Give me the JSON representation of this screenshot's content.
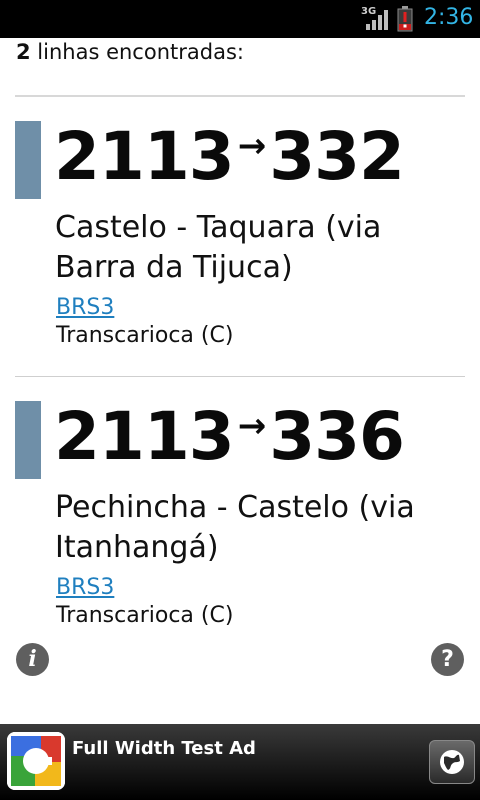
{
  "status_bar": {
    "network": "3G",
    "time": "2:36"
  },
  "results": {
    "count": "2",
    "count_label": " linhas encontradas:"
  },
  "lines": [
    {
      "from": "2113",
      "arrow": "→",
      "to": "332",
      "name": "Castelo - Taquara (via Barra da Tijuca)",
      "code": "BRS3",
      "system": "Transcarioca (C)"
    },
    {
      "from": "2113",
      "arrow": "→",
      "to": "336",
      "name": "Pechincha - Castelo (via Itanhangá)",
      "code": "BRS3",
      "system": "Transcarioca (C)"
    }
  ],
  "footer": {
    "info_icon_glyph": "i",
    "help_icon_glyph": "?"
  },
  "ad": {
    "title": "Full Width Test Ad"
  },
  "colors": {
    "accent_bar": "#6f8fa8",
    "link": "#1f7fbf",
    "status_time": "#33b5e5"
  }
}
